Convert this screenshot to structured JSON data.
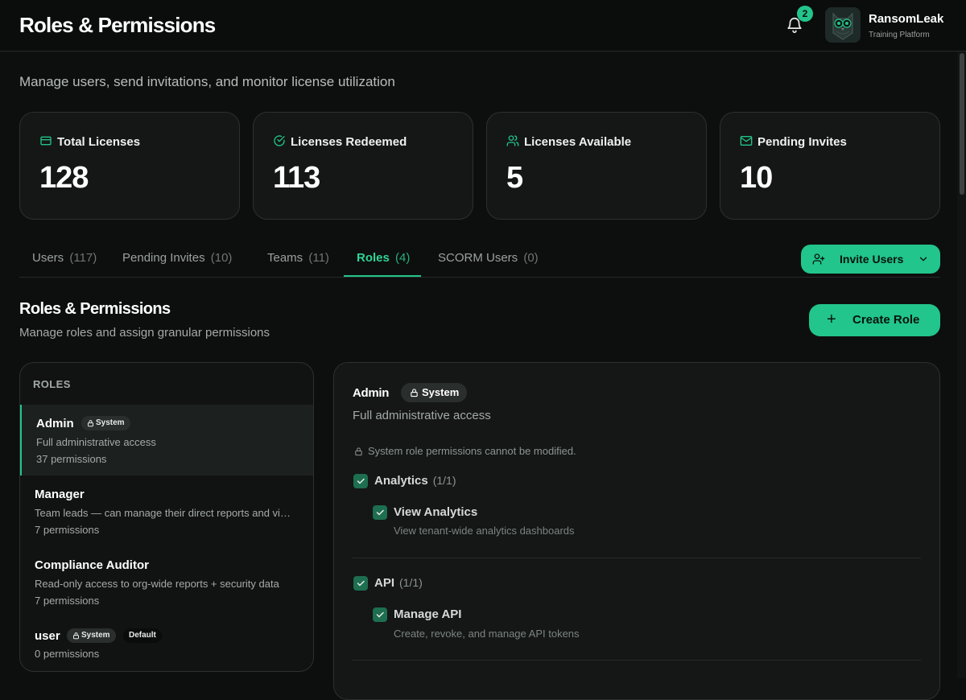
{
  "header": {
    "title": "Roles & Permissions",
    "notifications": "2",
    "brand_name": "RansomLeak",
    "brand_sub": "Training Platform"
  },
  "subtitle": "Manage users, send invitations, and monitor license utilization",
  "stats": [
    {
      "label": "Total Licenses",
      "value": "128",
      "icon": "card-icon"
    },
    {
      "label": "Licenses Redeemed",
      "value": "113",
      "icon": "check-circle-icon"
    },
    {
      "label": "Licenses Available",
      "value": "5",
      "icon": "users-icon"
    },
    {
      "label": "Pending Invites",
      "value": "10",
      "icon": "mail-icon"
    }
  ],
  "tabs": [
    {
      "label": "Users",
      "count": "(117)"
    },
    {
      "label": "Pending Invites",
      "count": "(10)"
    },
    {
      "label": "Teams",
      "count": "(11)"
    },
    {
      "label": "Roles",
      "count": "(4)"
    },
    {
      "label": "SCORM Users",
      "count": "(0)"
    }
  ],
  "invite_button": "Invite Users",
  "section": {
    "title": "Roles & Permissions",
    "subtitle": "Manage roles and assign granular permissions",
    "create_button": "Create Role"
  },
  "roles_panel": {
    "heading": "ROLES",
    "roles": [
      {
        "name": "Admin",
        "badge": "System",
        "description": "Full administrative access",
        "permissions": "37 permissions"
      },
      {
        "name": "Manager",
        "description": "Team leads — can manage their direct reports and view team analytics",
        "permissions": "7 permissions"
      },
      {
        "name": "Compliance Auditor",
        "description": "Read-only access to org-wide reports + security data",
        "permissions": "7 permissions"
      },
      {
        "name": "user",
        "badge": "System",
        "badge2": "Default",
        "permissions": "0 permissions"
      }
    ]
  },
  "detail": {
    "title": "Admin",
    "badge": "System",
    "subtitle": "Full administrative access",
    "note": "System role permissions cannot be modified.",
    "groups": [
      {
        "label": "Analytics",
        "count": "(1/1)",
        "perm": "View Analytics",
        "perm_desc": "View tenant-wide analytics dashboards"
      },
      {
        "label": "API",
        "count": "(1/1)",
        "perm": "Manage API",
        "perm_desc": "Create, revoke, and manage API tokens"
      }
    ]
  },
  "colors": {
    "accent": "#22c58b",
    "background": "#0d0f0e",
    "card": "#141716"
  }
}
